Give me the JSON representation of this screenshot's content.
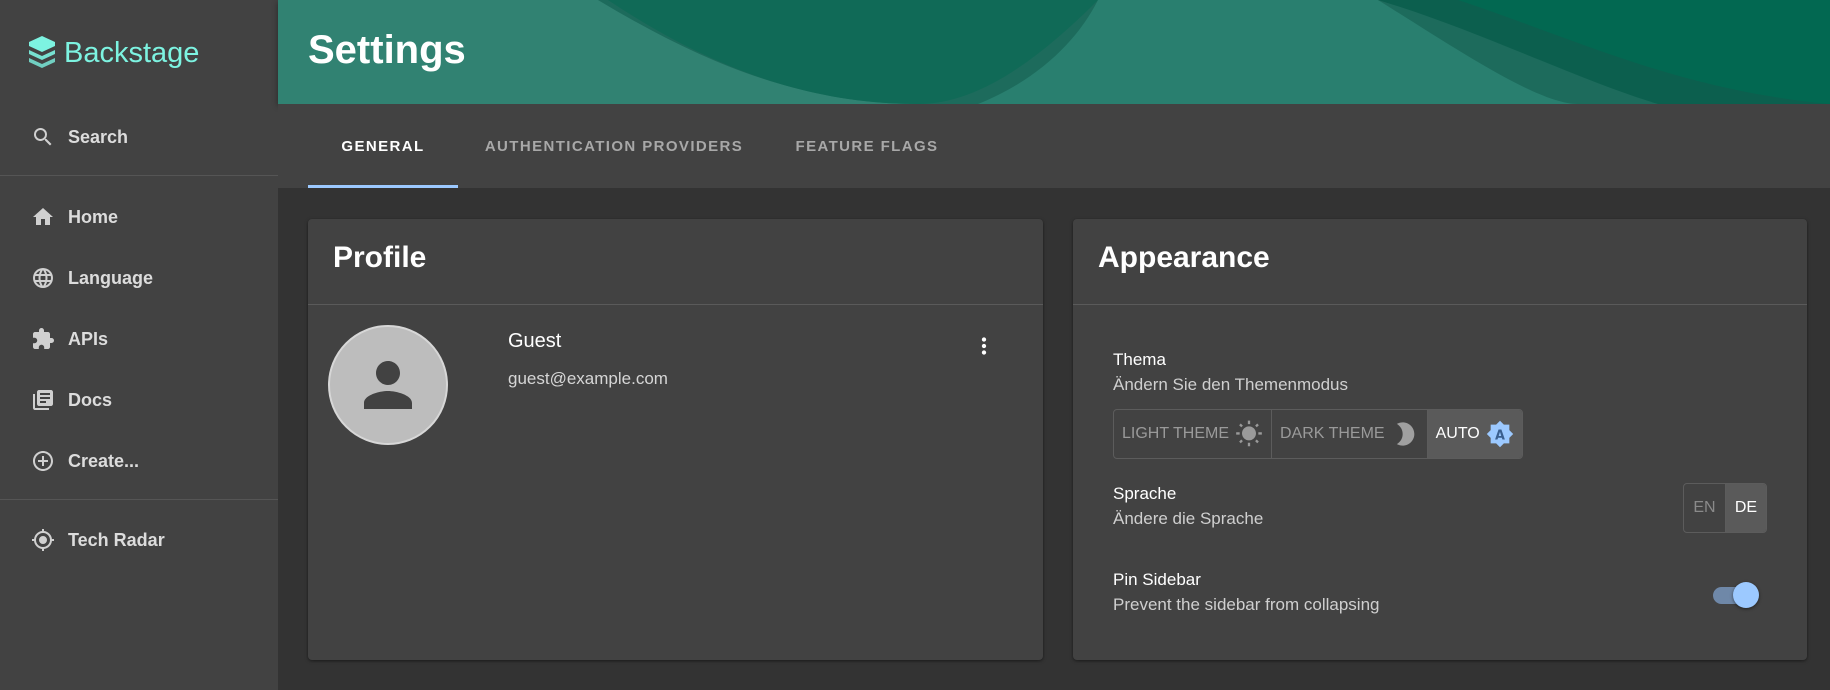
{
  "app": {
    "name": "Backstage",
    "brand_color": "#7df3e1"
  },
  "sidebar": {
    "search_label": "Search",
    "items": [
      {
        "label": "Home",
        "icon": "home-icon"
      },
      {
        "label": "Language",
        "icon": "globe-icon"
      },
      {
        "label": "APIs",
        "icon": "puzzle-icon"
      },
      {
        "label": "Docs",
        "icon": "library-books-icon"
      },
      {
        "label": "Create...",
        "icon": "add-circle-icon"
      }
    ],
    "plugins": [
      {
        "label": "Tech Radar",
        "icon": "radar-icon"
      }
    ]
  },
  "header": {
    "title": "Settings"
  },
  "tabs": [
    {
      "label": "GENERAL",
      "active": true
    },
    {
      "label": "AUTHENTICATION PROVIDERS",
      "active": false
    },
    {
      "label": "FEATURE FLAGS",
      "active": false
    }
  ],
  "profile": {
    "title": "Profile",
    "name": "Guest",
    "email": "guest@example.com"
  },
  "appearance": {
    "title": "Appearance",
    "theme": {
      "title": "Thema",
      "subtitle": "Ändern Sie den Themenmodus",
      "options": [
        {
          "label": "LIGHT THEME",
          "icon": "sun-icon"
        },
        {
          "label": "DARK THEME",
          "icon": "moon-icon"
        },
        {
          "label": "AUTO",
          "icon": "auto-mode-icon"
        }
      ],
      "selected": "AUTO"
    },
    "language": {
      "title": "Sprache",
      "subtitle": "Ändere die Sprache",
      "options": [
        "EN",
        "DE"
      ],
      "selected": "DE"
    },
    "pin_sidebar": {
      "title": "Pin Sidebar",
      "subtitle": "Prevent the sidebar from collapsing",
      "enabled": true
    }
  },
  "colors": {
    "accent": "#9cc9ff",
    "header": "#1f6e5e",
    "surface": "#424242",
    "background": "#333333"
  }
}
